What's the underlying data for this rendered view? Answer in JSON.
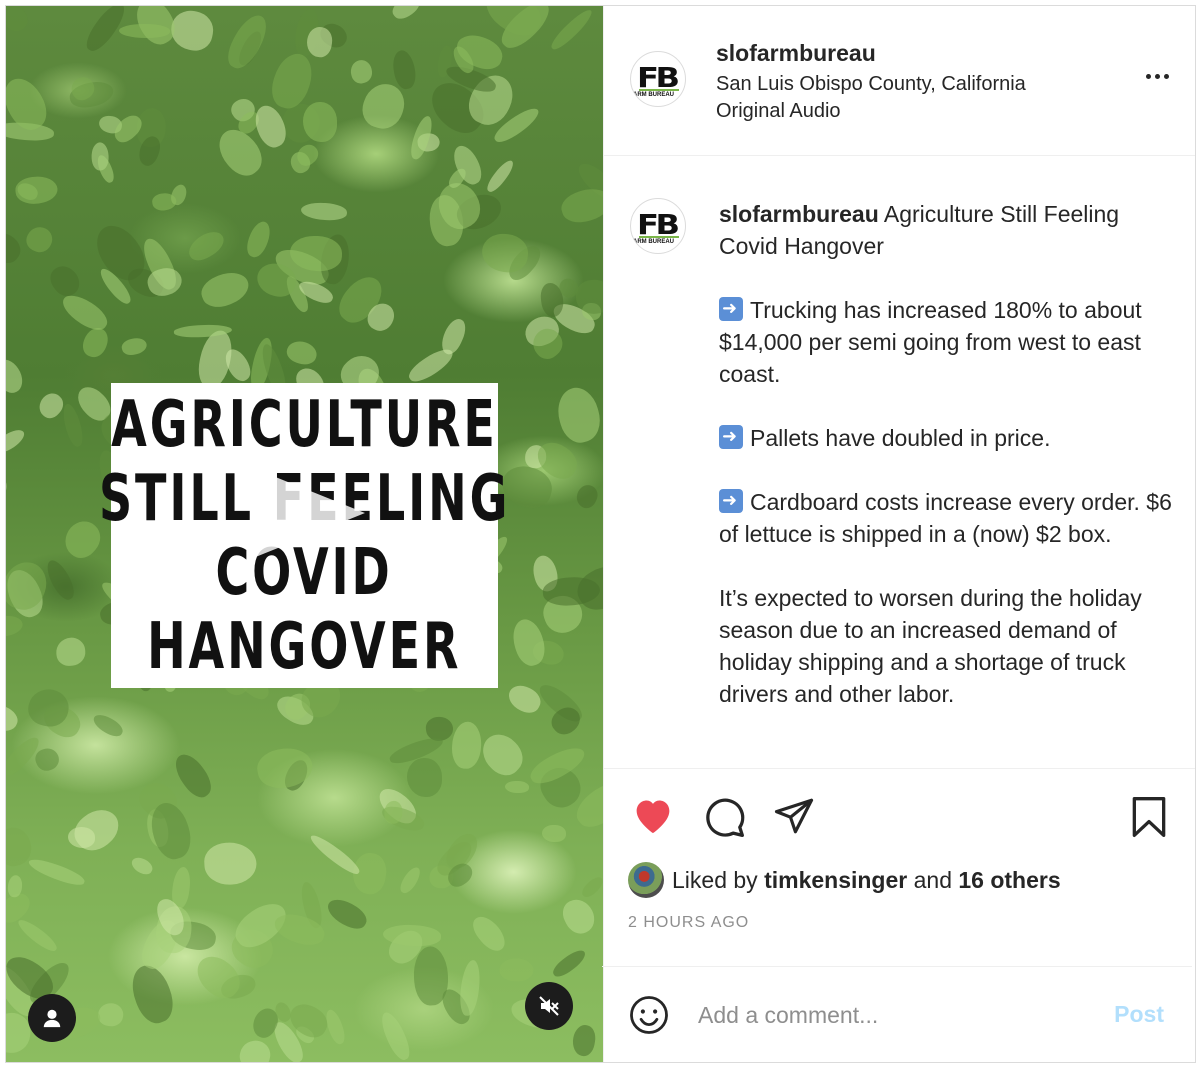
{
  "account": {
    "username": "slofarmbureau",
    "location": "San Luis Obispo County, California",
    "audio": "Original Audio"
  },
  "media": {
    "overlay_lines": [
      "AGRICULTURE",
      "STILL FEELING",
      "COVID",
      "HANGOVER"
    ],
    "play_icon": "play-icon",
    "user_icon": "user-icon",
    "mute_icon": "speaker-muted-icon"
  },
  "avatar": {
    "logo_text": "FB",
    "logo_subtext": "ARM BUREAU"
  },
  "caption": {
    "username": "slofarmbureau",
    "title": "Agriculture Still Feeling Covid Hangover",
    "bullets": [
      "Trucking has increased 180% to about $14,000 per semi going from west to east coast.",
      "Pallets have doubled in price.",
      "Cardboard costs increase every order. $6 of lettuce is shipped in a (now) $2 box."
    ],
    "paragraph": "It’s expected to worsen during the holiday season due to an increased demand of holiday shipping and a shortage of truck drivers and other labor."
  },
  "actions": {
    "like_icon": "heart-icon",
    "comment_icon": "comment-icon",
    "share_icon": "share-icon",
    "save_icon": "bookmark-icon",
    "like_color": "#ed4956"
  },
  "likes": {
    "prefix": "Liked by",
    "user": "timkensinger",
    "conj": "and",
    "others": "16 others"
  },
  "timestamp": "2 HOURS AGO",
  "comment_box": {
    "placeholder": "Add a comment...",
    "post_label": "Post"
  }
}
